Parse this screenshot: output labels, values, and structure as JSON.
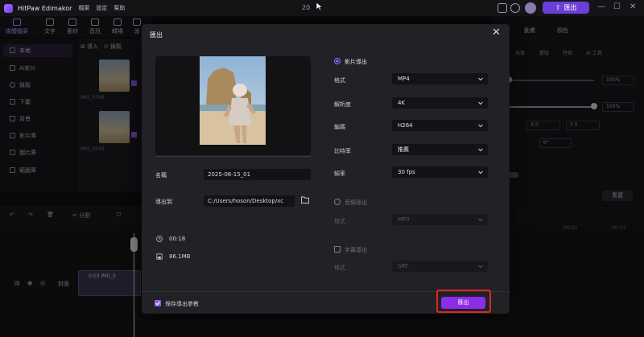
{
  "titlebar": {
    "app_name": "HitPaw Edimakor",
    "menus": [
      "檔案",
      "設定",
      "幫助"
    ],
    "doc_title": "20",
    "export_label": "匯出"
  },
  "nav": {
    "items": [
      "媒體檔案",
      "文字",
      "素材",
      "音訊",
      "轉場",
      "濾"
    ]
  },
  "left_panel": {
    "items": [
      "本地",
      "AI影片",
      "錄製",
      "下載",
      "背景",
      "影片庫",
      "圖片庫",
      "範圖庫"
    ]
  },
  "media": {
    "import_label": "導入",
    "record_label": "錄製",
    "clips": [
      "IMG_0706",
      "IMG_0703"
    ]
  },
  "right_panel": {
    "tabs": [
      "動畫",
      "顏色"
    ],
    "subtabs": [
      "去背",
      "蒙版",
      "特效",
      "AI 工具"
    ],
    "pct1": "100%",
    "pct2": "100%",
    "x_label": "X",
    "x_value": "0",
    "y_label": "Y",
    "y_value": "0",
    "rotation": "0°",
    "reset_label": "重置"
  },
  "timeline": {
    "split_label": "分割",
    "track_label": "封面",
    "clip_label": "0:03 IMG_0",
    "ruler": [
      "00:02",
      "00:03"
    ]
  },
  "modal": {
    "title": "匯出",
    "name_label": "名稱",
    "name_value": "2025-06-15_01",
    "export_to_label": "導出到",
    "export_path": "C:/Users/hoson/Desktop/xc",
    "duration": "00:18",
    "size": "86.1MB",
    "video_section": "影片導出",
    "format_label": "格式",
    "format_value": "MP4",
    "resolution_label": "解析度",
    "resolution_value": "4K",
    "codec_label": "編碼",
    "codec_value": "H264",
    "bitrate_label": "比特率",
    "bitrate_value": "推薦",
    "framerate_label": "幀率",
    "framerate_value": "30  fps",
    "audio_section": "音頻導出",
    "audio_format_label": "格式",
    "audio_format_value": "MP3",
    "subtitle_section": "字幕導出",
    "subtitle_format_label": "格式",
    "subtitle_format_value": "SRT",
    "save_params_label": "保存導出參數",
    "export_button": "匯出"
  },
  "colors": {
    "accent": "#8b2de8",
    "highlight": "#e02424"
  }
}
